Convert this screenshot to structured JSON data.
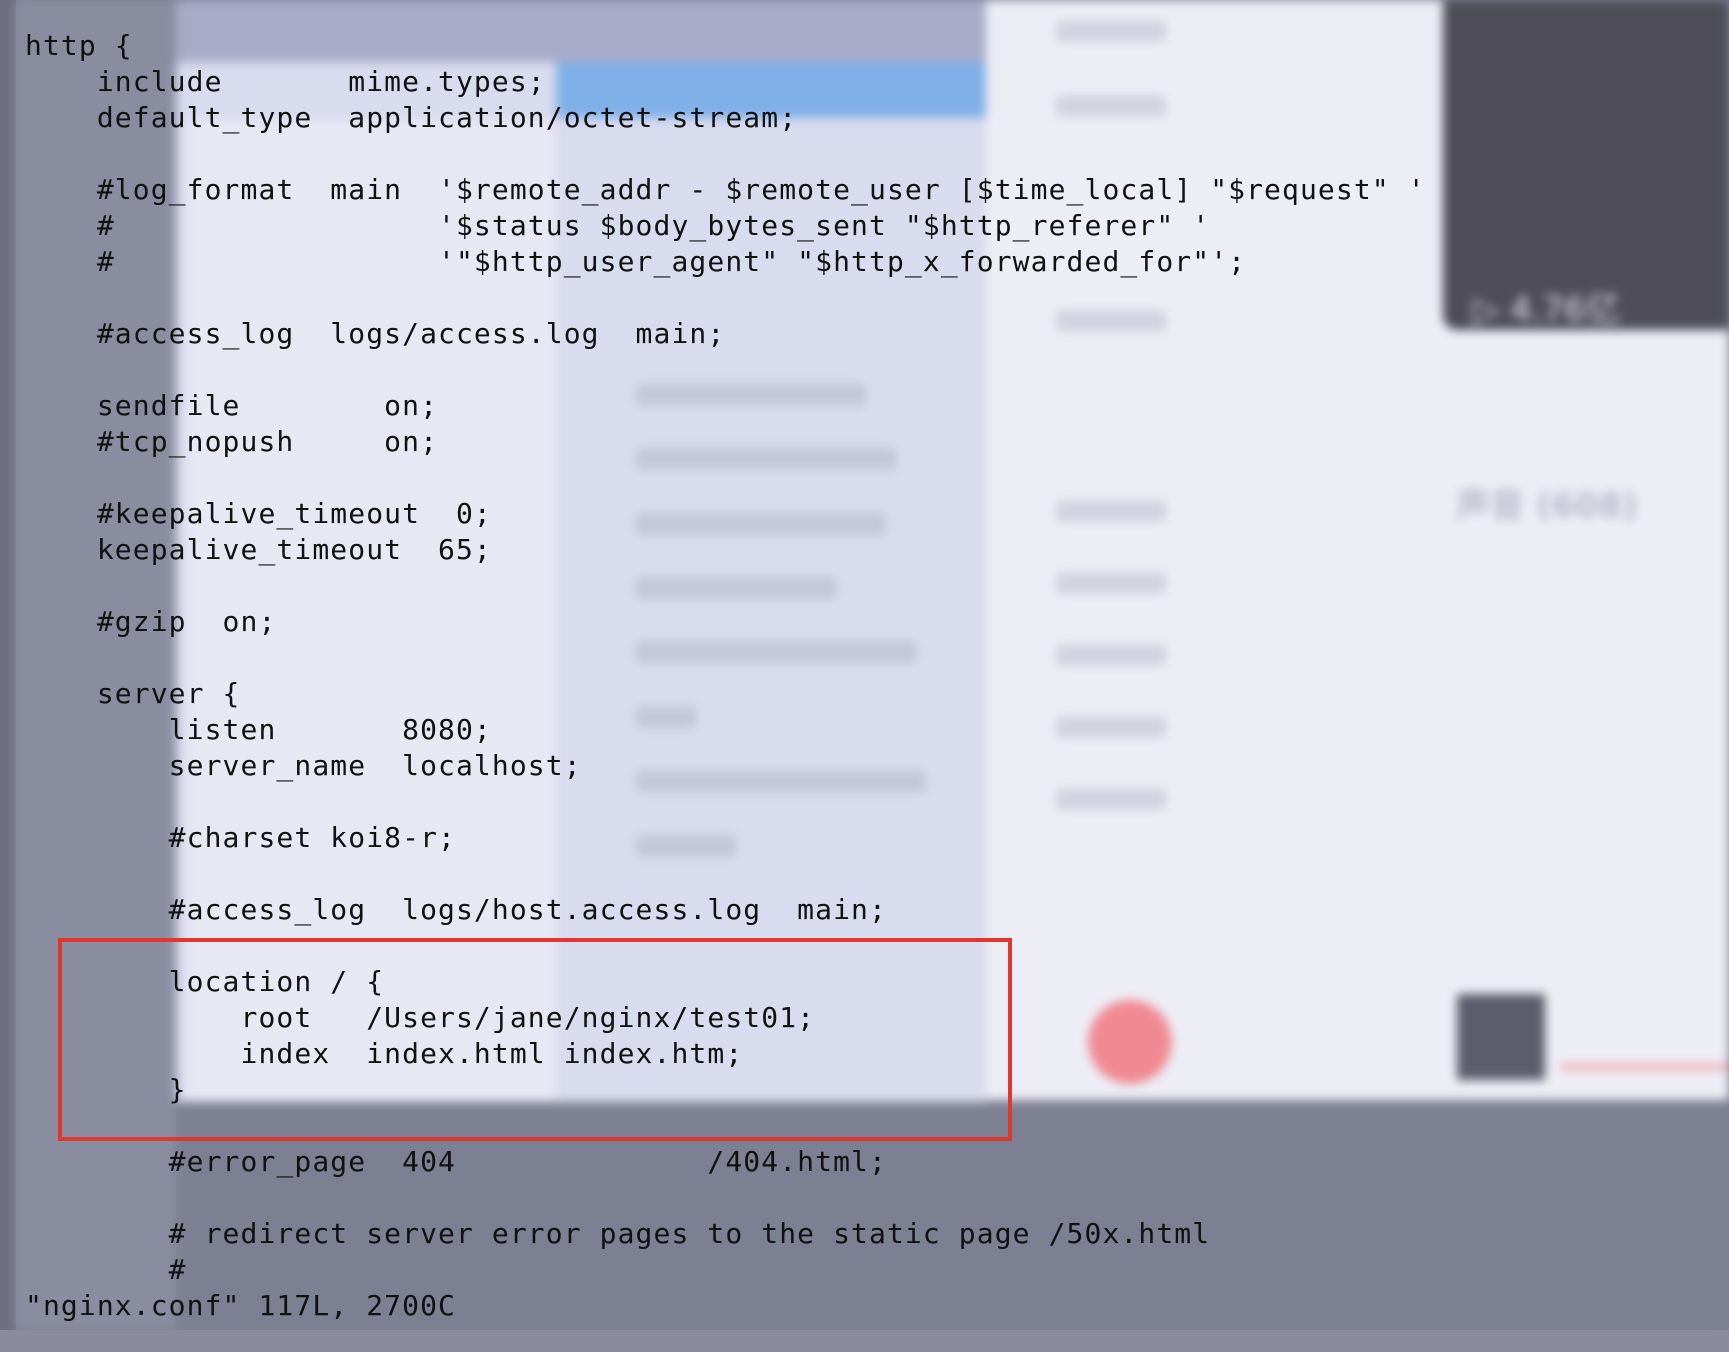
{
  "background_app": {
    "play_count": "▷ 4.76亿",
    "sounds_heading": "声音 (608)"
  },
  "editor": {
    "lines": [
      "http {",
      "    include       mime.types;",
      "    default_type  application/octet-stream;",
      "",
      "    #log_format  main  '$remote_addr - $remote_user [$time_local] \"$request\" '",
      "    #                  '$status $body_bytes_sent \"$http_referer\" '",
      "    #                  '\"$http_user_agent\" \"$http_x_forwarded_for\"';",
      "",
      "    #access_log  logs/access.log  main;",
      "",
      "    sendfile        on;",
      "    #tcp_nopush     on;",
      "",
      "    #keepalive_timeout  0;",
      "    keepalive_timeout  65;",
      "",
      "    #gzip  on;",
      "",
      "    server {",
      "        listen       8080;",
      "        server_name  localhost;",
      "",
      "        #charset koi8-r;",
      "",
      "        #access_log  logs/host.access.log  main;",
      "",
      "        location / {",
      "            root   /Users/jane/nginx/test01;",
      "            index  index.html index.htm;",
      "        }",
      "",
      "        #error_page  404              /404.html;",
      "",
      "        # redirect server error pages to the static page /50x.html",
      "        #"
    ],
    "status_line": "\"nginx.conf\" 117L, 2700C"
  },
  "highlight": {
    "color": "#e0382e"
  }
}
